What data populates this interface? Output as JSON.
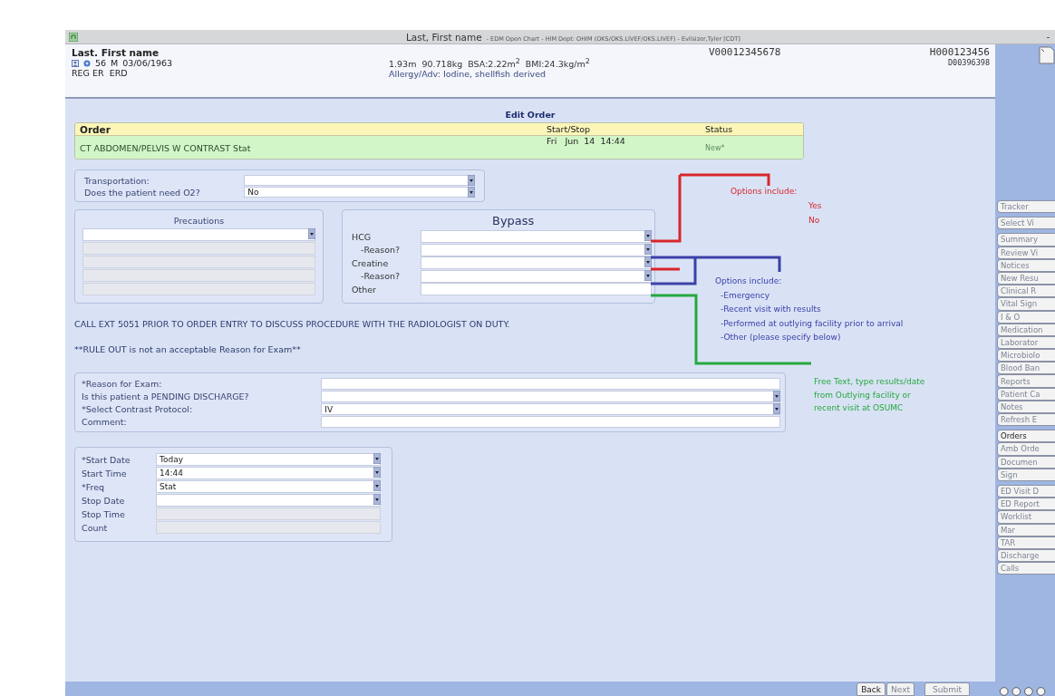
{
  "window": {
    "title": "Last, First name",
    "subtitle": "- EDM Open Chart - HIM Dept: OHIM (OKS/OKS.LIVEF/OKS.LIVEF) - Evilsizer,Tyler [CDT]",
    "minimize": "-"
  },
  "patient": {
    "name": "Last. First name",
    "age": "56",
    "sex": "M",
    "dob": "03/06/1963",
    "location": "REG ER  ERD",
    "measurements": "1.93m  90.718kg  BSA:2.22m$^{2}$  BMI:24.3kg/m$^{2}$",
    "allergy": "Allergy/Adv: Iodine, shellfish derived",
    "visit_number": "V00012345678",
    "mrn": "H000123456",
    "account": "D00396398"
  },
  "page_title": "Edit Order",
  "order": {
    "columns": [
      "Order",
      "Start/Stop",
      "Status"
    ],
    "name": "CT ABDOMEN/PELVIS W CONTRAST Stat",
    "start": "Fri   Jun  14  14:44",
    "status": "New*"
  },
  "transport_fields": [
    {
      "label": "Transportation:",
      "kind": "dropdown"
    },
    {
      "label": "Does the patient need O2?",
      "kind": "dropdown",
      "value": "No"
    }
  ],
  "precautions": {
    "title": "Precautions"
  },
  "bypass": {
    "title": "Bypass",
    "fields": [
      {
        "label": "HCG",
        "kind": "dropdown",
        "indented": false
      },
      {
        "label": "-Reason?",
        "kind": "dropdown",
        "indented": true
      },
      {
        "label": "Creatine",
        "kind": "dropdown",
        "indented": false
      },
      {
        "label": "-Reason?",
        "kind": "dropdown",
        "indented": true
      },
      {
        "label": "Other",
        "kind": "text",
        "indented": false
      }
    ]
  },
  "notices": [
    "CALL EXT 5051 PRIOR TO ORDER ENTRY TO DISCUSS PROCEDURE WITH THE RADIOLOGIST ON DUTY.",
    "**RULE OUT is not an acceptable Reason for Exam**"
  ],
  "exam_fields": [
    {
      "label": "*Reason for Exam:",
      "kind": "text"
    },
    {
      "label": "Is this patient a PENDING DISCHARGE?",
      "kind": "dropdown"
    },
    {
      "label": "*Select Contrast Protocol:",
      "kind": "dropdown",
      "value": "IV"
    },
    {
      "label": "Comment:",
      "kind": "text"
    }
  ],
  "schedule_fields": [
    {
      "label": "*Start Date",
      "kind": "dropdown",
      "value": "Today"
    },
    {
      "label": "Start Time",
      "kind": "dropdown",
      "value": "14:44"
    },
    {
      "label": "*Freq",
      "kind": "dropdown",
      "value": "Stat"
    },
    {
      "label": "Stop Date",
      "kind": "dropdown"
    },
    {
      "label": "Stop Time",
      "kind": "disabled"
    },
    {
      "label": "Count",
      "kind": "disabled"
    }
  ],
  "annotations": [
    {
      "color": "#d8262b",
      "lines": [
        "Options include:",
        "Yes",
        "No"
      ]
    },
    {
      "color": "#3b41a8",
      "lines": [
        "Options include:",
        "-Emergency",
        "-Recent visit with results",
        "-Performed at outlying facility prior to arrival",
        "-Other (please specify below)"
      ]
    },
    {
      "color": "#27a83f",
      "lines": [
        "Free Text, type results/date",
        "from Outlying facility or",
        "recent visit at OSUMC"
      ]
    }
  ],
  "sidebar": {
    "groups": [
      [
        {
          "label": "Tracker",
          "disabled": true
        }
      ],
      [
        {
          "label": "Select Vi",
          "disabled": true
        }
      ],
      [
        {
          "label": "Summary",
          "disabled": true
        },
        {
          "label": "Review Vi",
          "disabled": true
        },
        {
          "label": "Notices",
          "disabled": true
        },
        {
          "label": "New Resu",
          "disabled": true
        },
        {
          "label": "Clinical R",
          "disabled": true
        },
        {
          "label": "Vital Sign",
          "disabled": true
        },
        {
          "label": "I & O",
          "disabled": true
        },
        {
          "label": "Medication",
          "disabled": true
        },
        {
          "label": "Laborator",
          "disabled": true
        },
        {
          "label": "Microbiolo",
          "disabled": true
        },
        {
          "label": "Blood Ban",
          "disabled": true
        },
        {
          "label": "Reports",
          "disabled": true
        },
        {
          "label": "Patient Ca",
          "disabled": true
        },
        {
          "label": "Notes",
          "disabled": true
        },
        {
          "label": "Refresh E",
          "disabled": true
        }
      ],
      [
        {
          "label": "Orders",
          "disabled": false
        },
        {
          "label": "Amb Orde",
          "disabled": true
        },
        {
          "label": "Documen",
          "disabled": true
        },
        {
          "label": "Sign",
          "disabled": true
        }
      ],
      [
        {
          "label": "ED Visit D",
          "disabled": true
        },
        {
          "label": "ED Report",
          "disabled": true
        },
        {
          "label": "Worklist",
          "disabled": true
        },
        {
          "label": "Mar",
          "disabled": true
        },
        {
          "label": "TAR",
          "disabled": true
        },
        {
          "label": "Discharge",
          "disabled": true
        },
        {
          "label": "Calls",
          "disabled": true
        }
      ]
    ]
  },
  "footer_buttons": [
    {
      "label": "Back",
      "disabled": false
    },
    {
      "label": "Next",
      "disabled": true
    },
    {
      "label": "Submit",
      "disabled": true
    }
  ]
}
